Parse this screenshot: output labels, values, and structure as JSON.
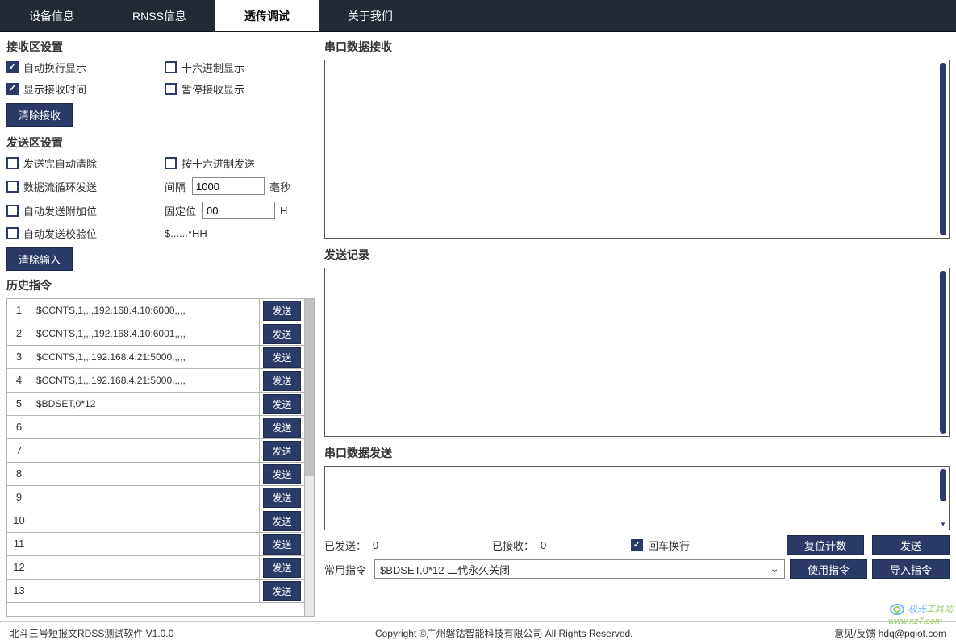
{
  "tabs": [
    "设备信息",
    "RNSS信息",
    "透传调试",
    "关于我们"
  ],
  "activeTab": 2,
  "recv_settings": {
    "title": "接收区设置",
    "auto_wrap": "自动换行显示",
    "hex_display": "十六进制显示",
    "show_time": "显示接收时间",
    "pause_display": "暂停接收显示",
    "clear_btn": "清除接收"
  },
  "send_settings": {
    "title": "发送区设置",
    "auto_clear": "发送完自动清除",
    "hex_send": "按十六进制发送",
    "loop_send": "数据流循环发送",
    "interval_lbl": "间隔",
    "interval_val": "1000",
    "interval_unit": "毫秒",
    "auto_append": "自动发送附加位",
    "fixed_lbl": "固定位",
    "fixed_val": "00",
    "fixed_unit": "H",
    "auto_checksum": "自动发送校验位",
    "checksum_pattern": "$......*HH",
    "clear_btn": "清除输入"
  },
  "history": {
    "title": "历史指令",
    "send_lbl": "发送",
    "rows": [
      {
        "idx": "1",
        "cmd": "$CCNTS,1,,,,192.168.4.10:6000,,,,"
      },
      {
        "idx": "2",
        "cmd": "$CCNTS,1,,,,192.168.4.10:6001,,,,"
      },
      {
        "idx": "3",
        "cmd": "$CCNTS,1,,,192.168.4.21:5000,,,,,"
      },
      {
        "idx": "4",
        "cmd": "$CCNTS,1,,,192.168.4.21:5000,,,,,"
      },
      {
        "idx": "5",
        "cmd": "$BDSET,0*12"
      },
      {
        "idx": "6",
        "cmd": ""
      },
      {
        "idx": "7",
        "cmd": ""
      },
      {
        "idx": "8",
        "cmd": ""
      },
      {
        "idx": "9",
        "cmd": ""
      },
      {
        "idx": "10",
        "cmd": ""
      },
      {
        "idx": "11",
        "cmd": ""
      },
      {
        "idx": "12",
        "cmd": ""
      },
      {
        "idx": "13",
        "cmd": ""
      }
    ]
  },
  "recv_area_title": "串口数据接收",
  "sendlog_title": "发送记录",
  "send_area_title": "串口数据发送",
  "stats": {
    "sent_lbl": "已发送：",
    "sent_val": "0",
    "recv_lbl": "已接收：",
    "recv_val": "0",
    "cr_newline": "回车换行",
    "reset_btn": "复位计数",
    "send_btn": "发送"
  },
  "common": {
    "lbl": "常用指令",
    "selected": "$BDSET,0*12 二代永久关闭",
    "use_btn": "使用指令",
    "import_btn": "导入指令"
  },
  "footer": {
    "left": "北斗三号短报文RDSS测试软件 V1.0.0",
    "center": "Copyright ©广州磐钴智能科技有限公司  All Rights Reserved.",
    "right": "意见/反馈 hdq@pgiot.com"
  },
  "watermark": "www.xz7.com"
}
